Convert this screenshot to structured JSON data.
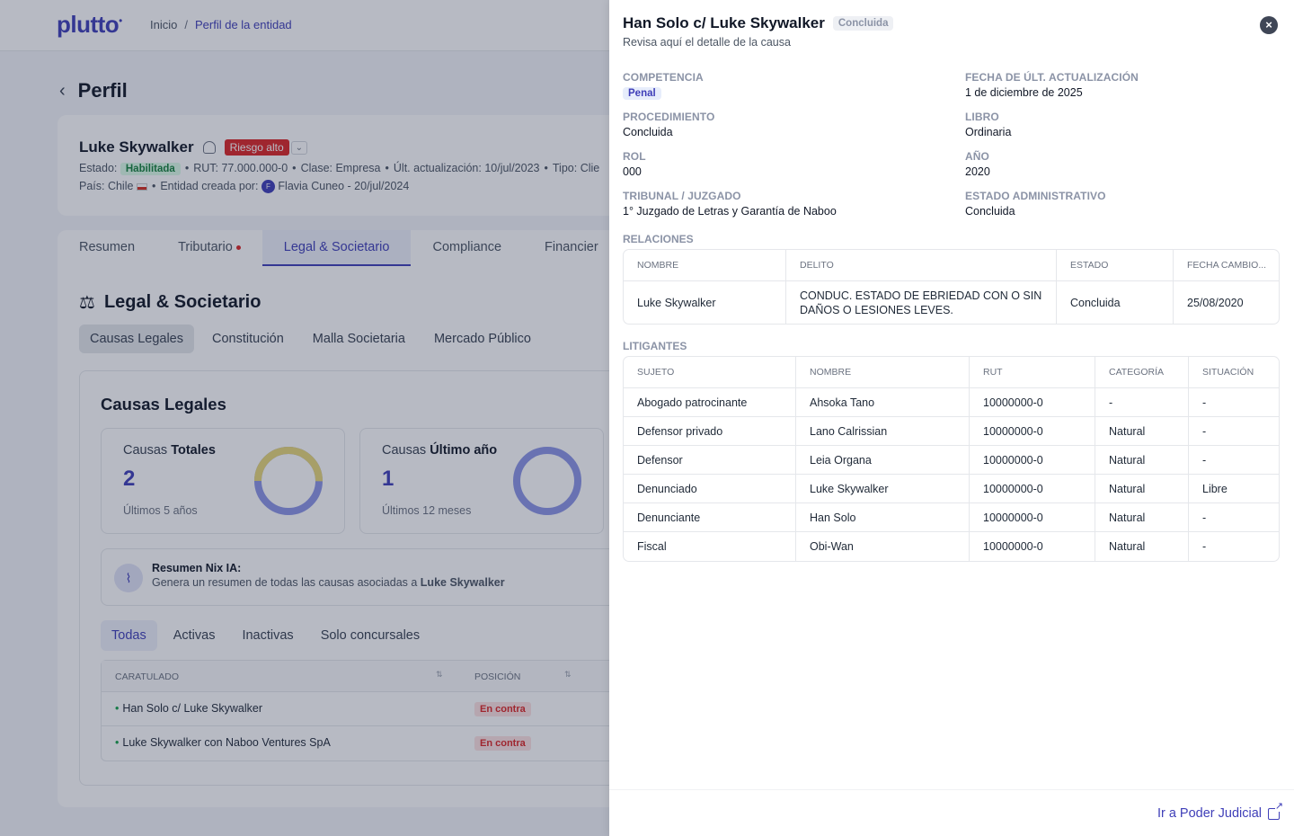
{
  "app": {
    "logo": "plutto",
    "breadcrumb": [
      "Inicio",
      "Perfil de la entidad"
    ]
  },
  "profile": {
    "back_icon": "chevron-left-icon",
    "title": "Perfil",
    "entity_name": "Luke Skywalker",
    "risk": "Riesgo alto",
    "meta_line1": {
      "estado_label": "Estado:",
      "estado": "Habilitada",
      "rut": "RUT: 77.000.000-0",
      "clase": "Clase: Empresa",
      "ult": "Últ. actualización: 10/jul/2023",
      "tipo": "Tipo: Clie"
    },
    "meta_line2": {
      "pais": "País: Chile",
      "creada_label": "Entidad creada por:",
      "avatar_letter": "F",
      "creada_por": "Flavia Cuneo - 20/jul/2024"
    }
  },
  "tabs": [
    "Resumen",
    "Tributario",
    "Legal & Societario",
    "Compliance",
    "Financier"
  ],
  "section": {
    "title": "Legal & Societario",
    "subtabs": [
      "Causas Legales",
      "Constitución",
      "Malla Societaria",
      "Mercado Público"
    ]
  },
  "causas": {
    "title": "Causas Legales",
    "totales": {
      "label_a": "Causas ",
      "label_b": "Totales",
      "value": "2",
      "sub": "Últimos 5 años"
    },
    "ultimo": {
      "label_a": "Causas ",
      "label_b": "Último año",
      "value": "1",
      "sub": "Últimos 12 meses"
    },
    "nix": {
      "title": "Resumen Nix IA:",
      "text": "Genera un resumen de todas las causas asociadas a ",
      "entity": "Luke Skywalker"
    },
    "filters": [
      "Todas",
      "Activas",
      "Inactivas",
      "Solo concursales"
    ],
    "table_headers": [
      "CARATULADO",
      "POSICIÓN"
    ],
    "rows": [
      {
        "caratulado": "Han Solo c/ Luke Skywalker",
        "posicion": "En contra"
      },
      {
        "caratulado": "Luke Skywalker con Naboo Ventures SpA",
        "posicion": "En contra"
      }
    ]
  },
  "drawer": {
    "title": "Han Solo c/ Luke Skywalker",
    "status": "Concluida",
    "subtitle": "Revisa aquí el detalle de la causa",
    "fields": {
      "competencia_k": "COMPETENCIA",
      "competencia_v": "Penal",
      "fecha_k": "FECHA DE ÚLT. ACTUALIZACIÓN",
      "fecha_v": "1 de diciembre de 2025",
      "procedimiento_k": "PROCEDIMIENTO",
      "procedimiento_v": "Concluida",
      "libro_k": "LIBRO",
      "libro_v": "Ordinaria",
      "rol_k": "ROL",
      "rol_v": "000",
      "anio_k": "AÑO",
      "anio_v": "2020",
      "tribunal_k": "TRIBUNAL / JUZGADO",
      "tribunal_v": "1° Juzgado de Letras y Garantía de Naboo",
      "estado_k": "ESTADO ADMINISTRATIVO",
      "estado_v": "Concluida"
    },
    "relaciones": {
      "label": "RELACIONES",
      "headers": [
        "NOMBRE",
        "DELITO",
        "ESTADO",
        "FECHA CAMBIO..."
      ],
      "rows": [
        [
          "Luke Skywalker",
          "CONDUC. ESTADO DE EBRIEDAD CON O SIN DAÑOS O LESIONES LEVES.",
          "Concluida",
          "25/08/2020"
        ]
      ]
    },
    "litigantes": {
      "label": "LITIGANTES",
      "headers": [
        "SUJETO",
        "NOMBRE",
        "RUT",
        "CATEGORÍA",
        "SITUACIÓN"
      ],
      "rows": [
        [
          "Abogado patrocinante",
          "Ahsoka Tano",
          "10000000-0",
          "-",
          "-"
        ],
        [
          "Defensor privado",
          "Lano Calrissian",
          "10000000-0",
          "Natural",
          "-"
        ],
        [
          "Defensor",
          "Leia Organa",
          "10000000-0",
          "Natural",
          "-"
        ],
        [
          "Denunciado",
          "Luke Skywalker",
          "10000000-0",
          "Natural",
          "Libre"
        ],
        [
          "Denunciante",
          "Han Solo",
          "10000000-0",
          "Natural",
          "-"
        ],
        [
          "Fiscal",
          "Obi-Wan",
          "10000000-0",
          "Natural",
          "-"
        ]
      ]
    },
    "footer_link": "Ir a Poder Judicial"
  },
  "colors": {
    "brand": "#3f3fb8",
    "danger": "#dc2626",
    "success": "#15803d"
  }
}
